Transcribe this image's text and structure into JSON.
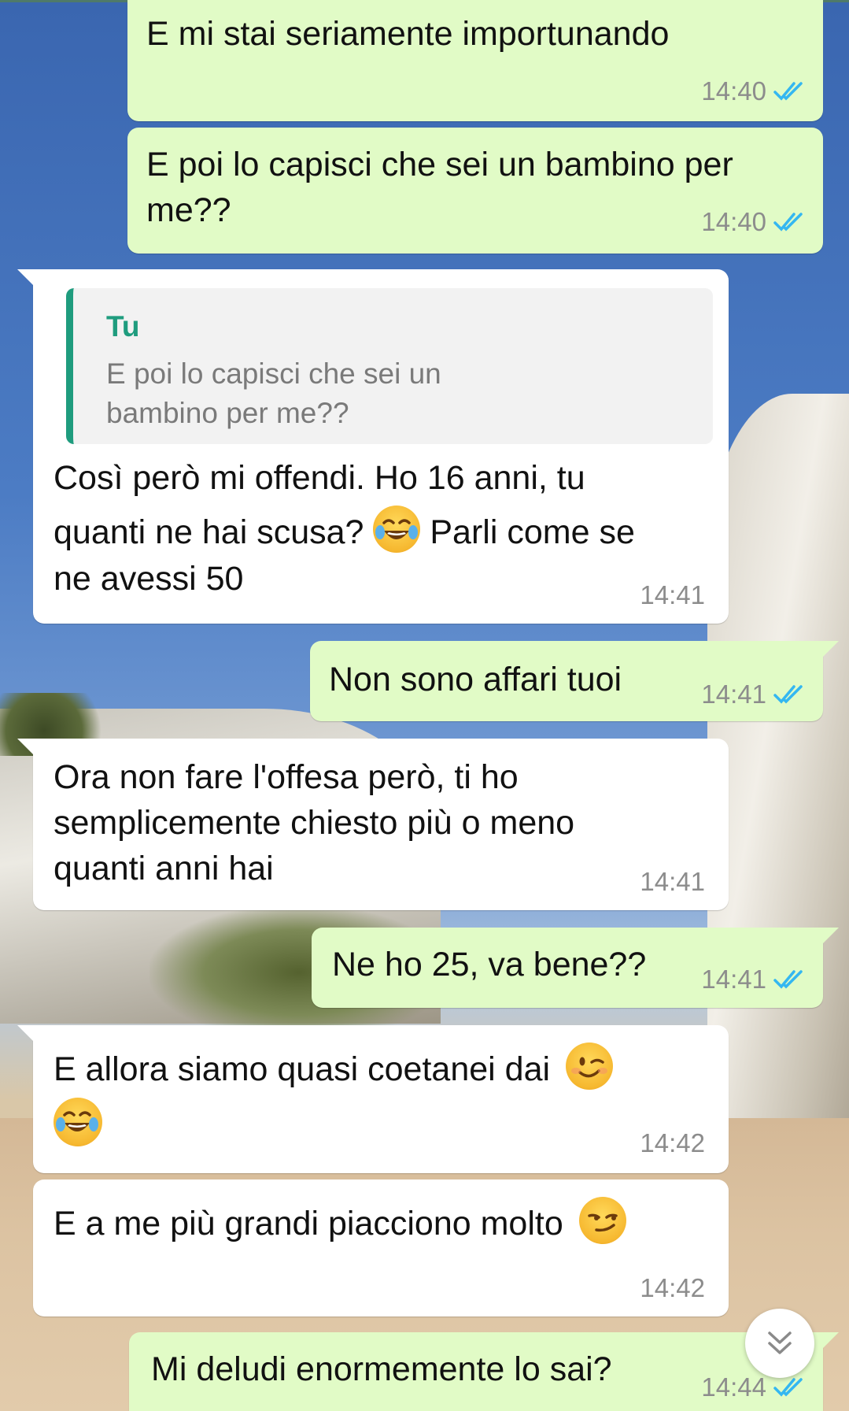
{
  "colors": {
    "outgoing_bubble": "#e1fbc6",
    "incoming_bubble": "#ffffff",
    "read_ticks": "#34b7f1",
    "quote_accent": "#1f9c7e"
  },
  "messages": [
    {
      "id": "m1",
      "direction": "outgoing",
      "text": "E mi stai seriamente importunando",
      "time": "14:40",
      "status": "read"
    },
    {
      "id": "m2",
      "direction": "outgoing",
      "line1": "E poi lo capisci che sei un bambino per",
      "line2": "me??",
      "time": "14:40",
      "status": "read"
    },
    {
      "id": "m3",
      "direction": "incoming",
      "quote": {
        "author": "Tu",
        "line1": "E poi lo capisci che sei un",
        "line2": "bambino per me??"
      },
      "line1": "Così però mi offendi. Ho 16 anni, tu",
      "line2a": "quanti ne hai scusa?",
      "emoji": "face-with-tears-of-joy",
      "line2b": "Parli come se",
      "line3": "ne avessi 50",
      "time": "14:41"
    },
    {
      "id": "m4",
      "direction": "outgoing",
      "text": "Non sono affari tuoi",
      "time": "14:41",
      "status": "read"
    },
    {
      "id": "m5",
      "direction": "incoming",
      "line1": "Ora non fare l'offesa però, ti ho",
      "line2": "semplicemente chiesto più o meno",
      "line3": "quanti anni hai",
      "time": "14:41"
    },
    {
      "id": "m6",
      "direction": "outgoing",
      "text": "Ne ho 25, va bene??",
      "time": "14:41",
      "status": "read"
    },
    {
      "id": "m7",
      "direction": "incoming",
      "line1": "E allora siamo quasi coetanei dai",
      "emoji1": "winking-face",
      "emoji2": "face-with-tears-of-joy",
      "time": "14:42"
    },
    {
      "id": "m8",
      "direction": "incoming",
      "text": "E a me più grandi piacciono molto",
      "emoji": "smirking-face",
      "time": "14:42"
    },
    {
      "id": "m9",
      "direction": "outgoing",
      "text": "Mi deludi enormemente lo sai?",
      "time": "14:44",
      "status": "read"
    }
  ],
  "scroll_button": {
    "icon": "double-chevron-down-icon"
  }
}
